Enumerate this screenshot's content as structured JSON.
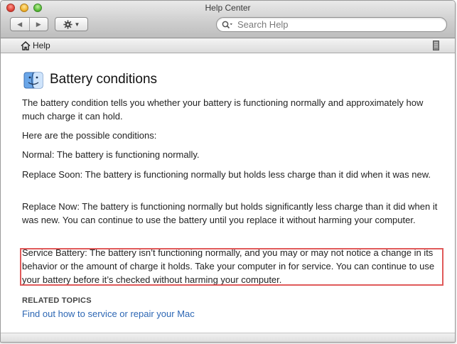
{
  "window": {
    "title": "Help Center"
  },
  "toolbar": {
    "back_label": "◀",
    "forward_label": "▶",
    "action_icon": "gear-icon",
    "search": {
      "placeholder": "Search Help"
    }
  },
  "bookmarks": {
    "home_label": "Help"
  },
  "article": {
    "title": "Battery conditions",
    "paragraphs": [
      "The battery condition tells you whether your battery is functioning normally and approximately how much charge it can hold.",
      "Here are the possible conditions:",
      "Normal: The battery is functioning normally.",
      "Replace Soon: The battery is functioning normally but holds less charge than it did when it was new.",
      "Replace Now: The battery is functioning normally but holds significantly less charge than it did when it was new. You can continue to use the battery until you replace it without harming your computer.",
      "Service Battery: The battery isn’t functioning normally, and you may or may not notice a change in its behavior or the amount of charge it holds. Take your computer in for service. You can continue to use your battery before it’s checked without harming your computer."
    ],
    "related_heading": "RELATED TOPICS",
    "related_links": [
      "Find out how to service or repair your Mac"
    ]
  },
  "colors": {
    "highlight_border": "#e05a5a",
    "link": "#2d67b4"
  }
}
